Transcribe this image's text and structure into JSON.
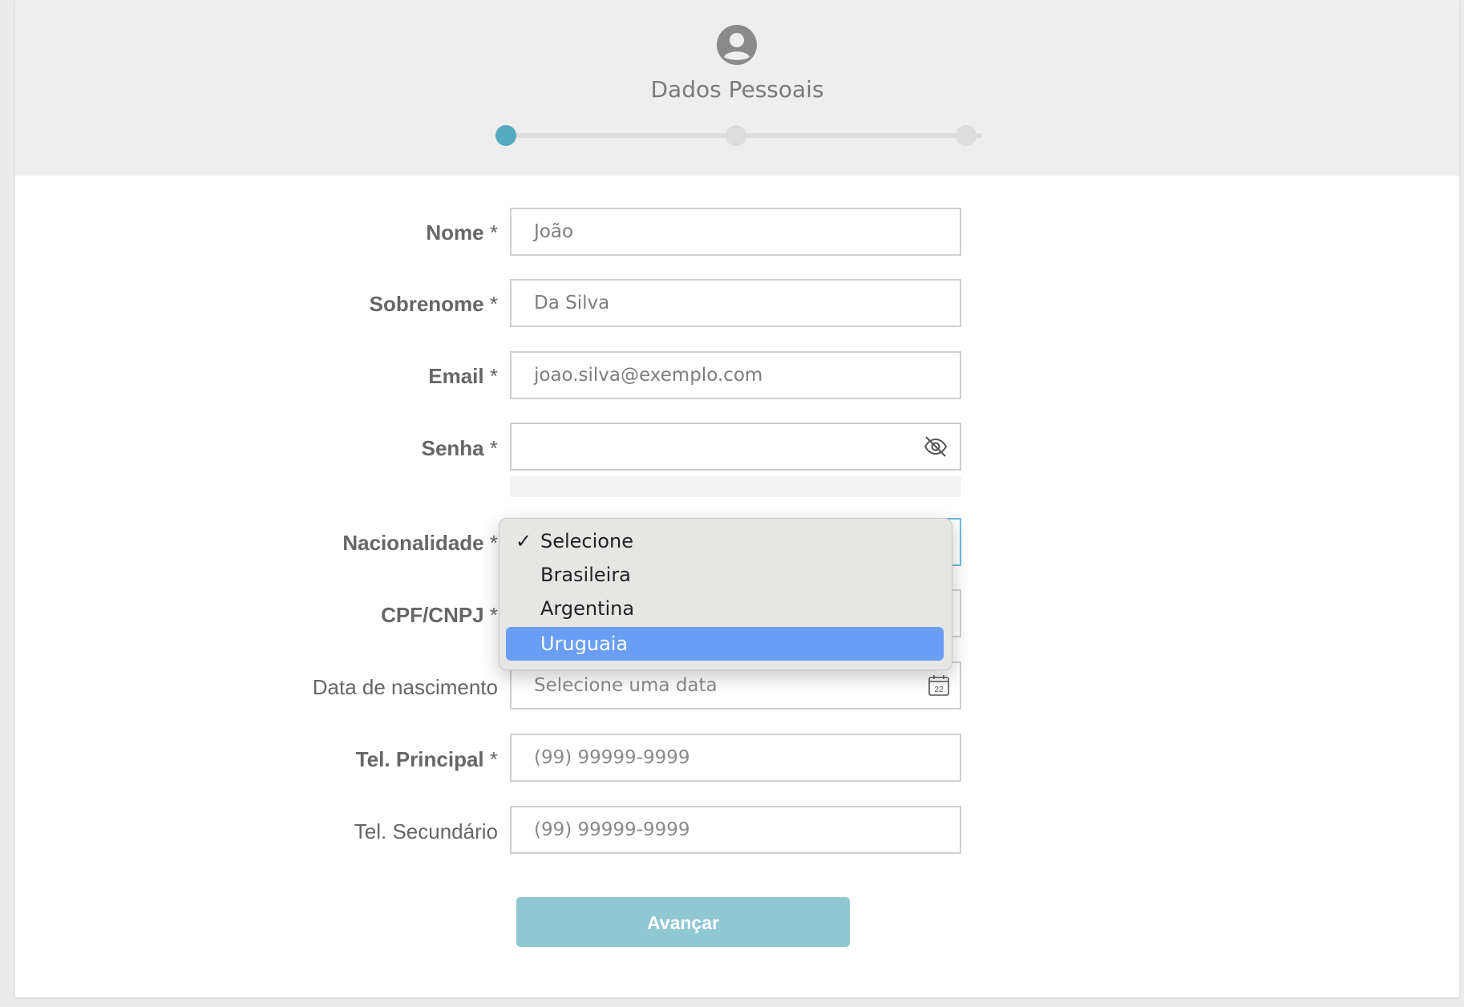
{
  "header": {
    "step_title": "Dados Pessoais",
    "icon": "user-circle-icon",
    "steps": [
      {
        "state": "active"
      },
      {
        "state": "inactive"
      },
      {
        "state": "inactive"
      }
    ],
    "colors": {
      "active": "#55aabf",
      "inactive": "#dddddd"
    }
  },
  "form": {
    "nome": {
      "label": "Nome",
      "required": "*",
      "value": "João"
    },
    "sobrenome": {
      "label": "Sobrenome",
      "required": "*",
      "value": "Da Silva"
    },
    "email": {
      "label": "Email",
      "required": "*",
      "value": "joao.silva@exemplo.com"
    },
    "senha": {
      "label": "Senha",
      "required": "*",
      "value": "",
      "toggle_icon": "eye-off-icon"
    },
    "nacionalidade": {
      "label": "Nacionalidade",
      "required": "*",
      "selected": "Selecione",
      "options": [
        "Selecione",
        "Brasileira",
        "Argentina",
        "Uruguaia"
      ],
      "highlighted": "Uruguaia",
      "check_mark": "✓"
    },
    "cpf": {
      "label": "CPF/CNPJ",
      "required": "*"
    },
    "nascimento": {
      "label": "Data de nascimento",
      "placeholder": "Selecione uma data",
      "icon": "calendar-icon",
      "calendar_day": "22"
    },
    "tel_principal": {
      "label": "Tel. Principal",
      "required": "*",
      "placeholder": "(99) 99999-9999"
    },
    "tel_secundario": {
      "label": "Tel. Secundário",
      "placeholder": "(99) 99999-9999"
    }
  },
  "actions": {
    "next_label": "Avançar",
    "next_color": "#8fc7d3"
  }
}
